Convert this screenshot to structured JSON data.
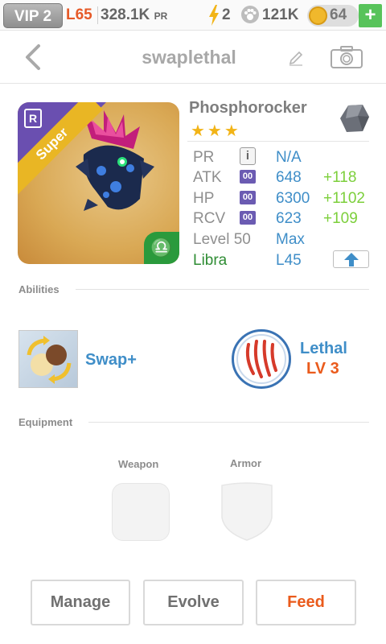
{
  "status_bar": {
    "vip": "VIP 2",
    "level": "L65",
    "power_rating": "328.1K",
    "power_rating_unit": "PR",
    "energy": "2",
    "paw_count": "121K",
    "coins": "64",
    "add_label": "+",
    "colors": {
      "level": "#e65a28",
      "add_button": "#57c35a",
      "coin": "#f0b82c"
    }
  },
  "nav": {
    "title": "swaplethal",
    "icons": [
      "chevron-left-icon",
      "pencil-icon",
      "camera-icon"
    ]
  },
  "monster": {
    "name": "Phosphorocker",
    "stars": "★★★",
    "rarity_label": "Super",
    "rarity_badge": "R",
    "zodiac_symbol": "♎",
    "element_icon": "rock-element-icon",
    "stats": {
      "pr": {
        "label": "PR",
        "info_icon": "i",
        "value": "N/A"
      },
      "atk": {
        "label": "ATK",
        "icon_text": "00",
        "value": "648",
        "bonus": "+118"
      },
      "hp": {
        "label": "HP",
        "icon_text": "00",
        "value": "6300",
        "bonus": "+1102"
      },
      "rcv": {
        "label": "RCV",
        "icon_text": "00",
        "value": "623",
        "bonus": "+109"
      },
      "level": {
        "label": "Level 50",
        "value": "Max"
      },
      "zodiac": {
        "label": "Libra",
        "value": "L45"
      }
    }
  },
  "abilities": {
    "header": "Abilities",
    "items": [
      {
        "name": "Swap+",
        "icon": "swap-icon"
      },
      {
        "name": "Lethal",
        "level": "LV 3",
        "icon": "claw-marks-icon"
      }
    ]
  },
  "equipment": {
    "header": "Equipment",
    "slots": [
      {
        "label": "Weapon"
      },
      {
        "label": "Armor"
      }
    ]
  },
  "actions": {
    "manage": "Manage",
    "evolve": "Evolve",
    "feed": "Feed"
  }
}
